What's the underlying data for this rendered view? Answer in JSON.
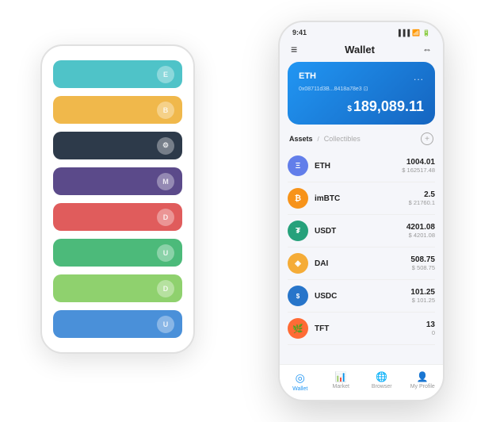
{
  "scene": {
    "phone_back": {
      "bars": [
        {
          "id": "teal",
          "class": "bar-teal",
          "symbol": "E"
        },
        {
          "id": "yellow",
          "class": "bar-yellow",
          "symbol": "B"
        },
        {
          "id": "dark",
          "class": "bar-dark",
          "symbol": "⚙"
        },
        {
          "id": "purple",
          "class": "bar-purple",
          "symbol": "M"
        },
        {
          "id": "red",
          "class": "bar-red",
          "symbol": "D"
        },
        {
          "id": "green",
          "class": "bar-green",
          "symbol": "U"
        },
        {
          "id": "lgreen",
          "class": "bar-lgreen",
          "symbol": "D"
        },
        {
          "id": "blue",
          "class": "bar-blue",
          "symbol": "U"
        }
      ]
    },
    "phone_front": {
      "status": {
        "time": "9:41",
        "signal": "▐▐▐",
        "wifi": "wifi",
        "battery": "🔋"
      },
      "header": {
        "menu_icon": "≡",
        "title": "Wallet",
        "scan_icon": "⇔"
      },
      "wallet_card": {
        "coin_label": "ETH",
        "dots": "...",
        "address": "0x08711d3B...8418a78e3  ⊡",
        "dollar_sign": "$",
        "amount": "189,089.11"
      },
      "assets_section": {
        "tab_active": "Assets",
        "tab_divider": "/",
        "tab_inactive": "Collectibles",
        "add_icon": "+"
      },
      "assets": [
        {
          "id": "eth",
          "name": "ETH",
          "icon_class": "icon-eth",
          "icon_text": "Ξ",
          "amount": "1004.01",
          "usd": "$ 162517.48"
        },
        {
          "id": "imbtc",
          "name": "imBTC",
          "icon_class": "icon-imbtc",
          "icon_text": "₿",
          "amount": "2.5",
          "usd": "$ 21760.1"
        },
        {
          "id": "usdt",
          "name": "USDT",
          "icon_class": "icon-usdt",
          "icon_text": "₮",
          "amount": "4201.08",
          "usd": "$ 4201.08"
        },
        {
          "id": "dai",
          "name": "DAI",
          "icon_class": "icon-dai",
          "icon_text": "◈",
          "amount": "508.75",
          "usd": "$ 508.75"
        },
        {
          "id": "usdc",
          "name": "USDC",
          "icon_class": "icon-usdc",
          "icon_text": "$",
          "amount": "101.25",
          "usd": "$ 101.25"
        },
        {
          "id": "tft",
          "name": "TFT",
          "icon_class": "icon-tft",
          "icon_text": "🌿",
          "amount": "13",
          "usd": "0"
        }
      ],
      "nav": [
        {
          "id": "wallet",
          "label": "Wallet",
          "icon": "◎",
          "active": true
        },
        {
          "id": "market",
          "label": "Market",
          "icon": "📊",
          "active": false
        },
        {
          "id": "browser",
          "label": "Browser",
          "icon": "🌐",
          "active": false
        },
        {
          "id": "profile",
          "label": "My Profile",
          "icon": "👤",
          "active": false
        }
      ]
    }
  }
}
